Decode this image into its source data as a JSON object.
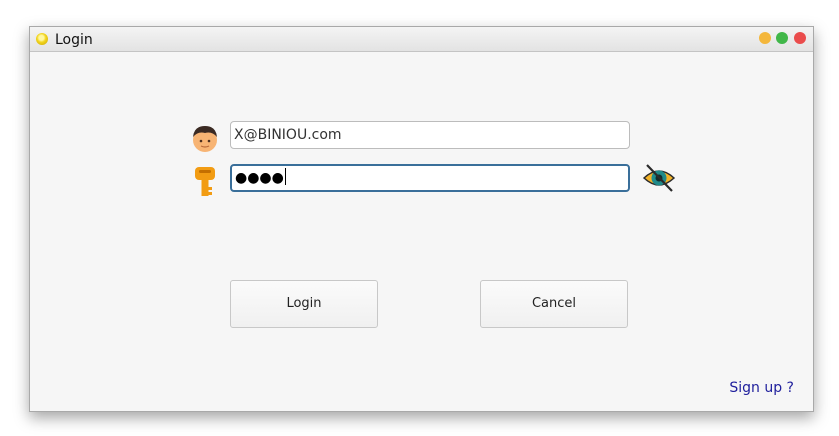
{
  "window": {
    "title": "Login",
    "app_icon": "yellow-circle-icon",
    "controls": [
      "minimize",
      "maximize",
      "close"
    ]
  },
  "form": {
    "username": {
      "icon": "user-avatar-icon",
      "value": "X@BINIOU.com"
    },
    "password": {
      "icon": "key-icon",
      "masked_value": "●●●●",
      "toggle_icon": "eye-hidden-icon"
    }
  },
  "buttons": {
    "login_label": "Login",
    "cancel_label": "Cancel"
  },
  "links": {
    "signup_label": "Sign up ?"
  },
  "colors": {
    "window_bg": "#f6f6f6",
    "focus_border": "#3a6f9a",
    "link": "#1e1e9c",
    "key": "#f29c13",
    "eye": "#1f8a8a"
  }
}
